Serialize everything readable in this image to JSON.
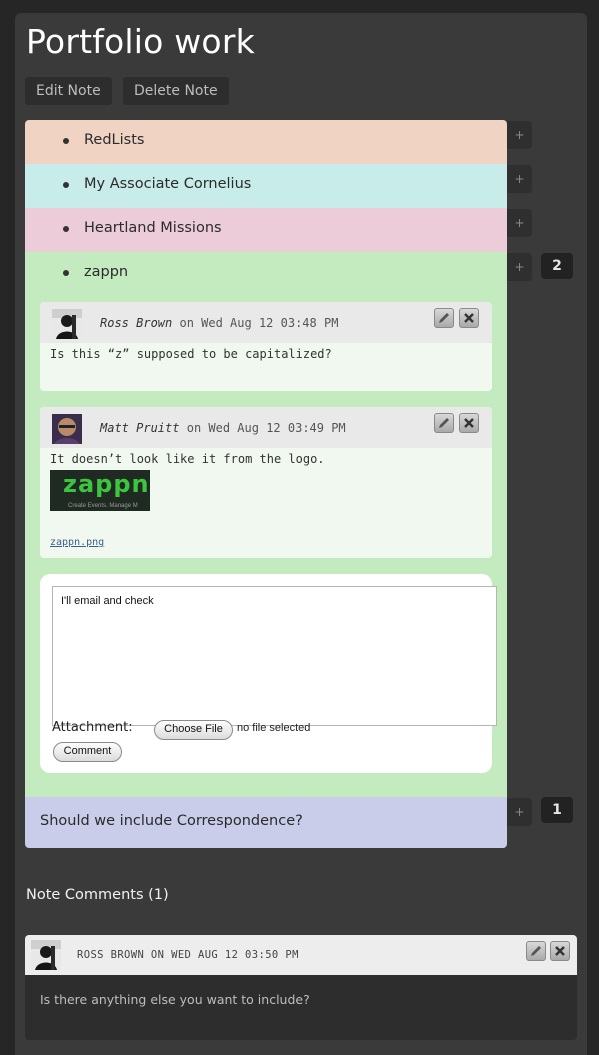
{
  "page": {
    "title": "Portfolio work"
  },
  "toolbar": {
    "edit_label": "Edit Note",
    "delete_label": "Delete Note"
  },
  "list": {
    "items": [
      {
        "label": "RedLists",
        "color": "#f0d3c3",
        "plus": "+"
      },
      {
        "label": "My Associate Cornelius",
        "color": "#c7ecea",
        "plus": "+"
      },
      {
        "label": "Heartland Missions",
        "color": "#ecccd8",
        "plus": "+"
      },
      {
        "label": "zappn",
        "color": "#c3ebbf",
        "plus": "+",
        "badge": "2"
      }
    ],
    "question": {
      "label": "Should we include Correspondence?",
      "color": "#c9cde9",
      "plus": "+",
      "badge": "1"
    }
  },
  "thread": {
    "comments": [
      {
        "author": "Ross Brown",
        "meta": "on Wed Aug 12 03:48 PM",
        "text": "Is this “z” supposed to be capitalized?"
      },
      {
        "author": "Matt Pruitt",
        "meta": "on Wed Aug 12 03:49 PM",
        "text": "It doesn’t look like it from the logo.",
        "attachment": {
          "image_text": "zappn",
          "image_tagline": "Create Events. Manage M",
          "link": "zappn.png"
        }
      }
    ],
    "reply": {
      "text": "I'll email and check",
      "attachment_label": "Attachment:",
      "choose_file_label": "Choose File",
      "no_file_text": "no file selected",
      "comment_button": "Comment"
    }
  },
  "note_comments": {
    "heading": "Note Comments (1)",
    "items": [
      {
        "byline": "ROSS BROWN ON WED AUG 12 03:50 PM",
        "text": "Is there anything else you want to include?"
      }
    ]
  },
  "colors": {
    "background": "#262626",
    "panel": "#3a3a3a",
    "zappn_green": "#3ec43e"
  }
}
